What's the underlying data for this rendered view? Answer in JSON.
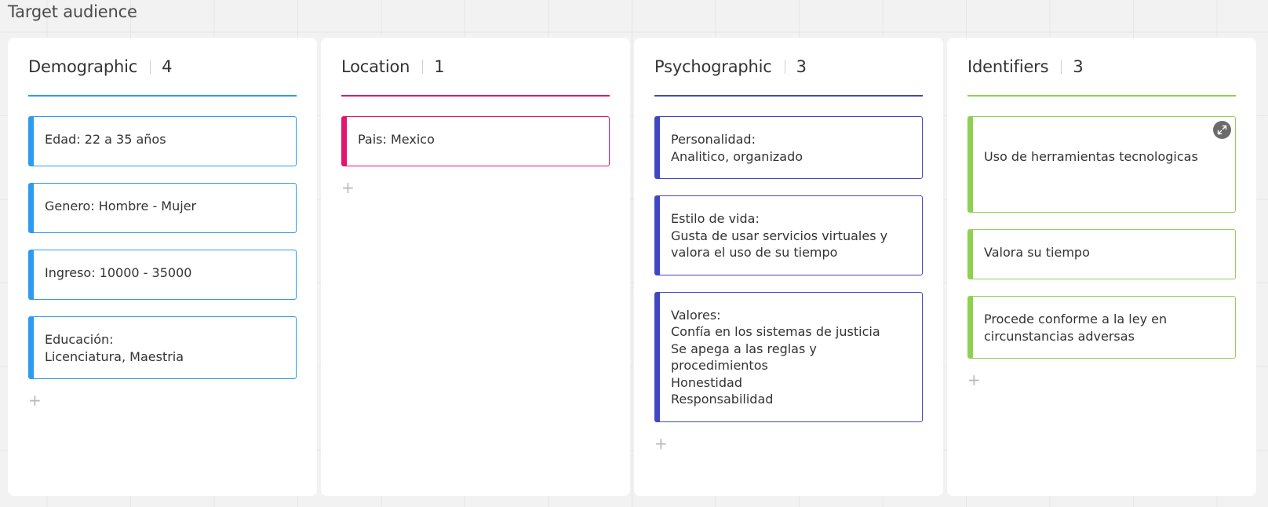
{
  "board": {
    "title": "Target audience"
  },
  "add_glyph": "+",
  "columns": [
    {
      "name": "Demographic",
      "count": "4",
      "color": "#2d9bf0",
      "cards": [
        "Edad: 22 a 35 años",
        "Genero: Hombre - Mujer",
        "Ingreso: 10000 - 35000",
        "Educación:\nLicenciatura, Maestria"
      ]
    },
    {
      "name": "Location",
      "count": "1",
      "color": "#e0166f",
      "cards": [
        "Pais: Mexico"
      ]
    },
    {
      "name": "Psychographic",
      "count": "3",
      "color": "#4146c2",
      "cards": [
        "Personalidad:\nAnalitico, organizado",
        "Estilo de vida:\nGusta de usar servicios virtuales y\nvalora el uso de su tiempo",
        "Valores:\nConfía en los sistemas de justicia\nSe apega a las reglas y\nprocedimientos\nHonestidad\nResponsabilidad"
      ]
    },
    {
      "name": "Identifiers",
      "count": "3",
      "color": "#8fd14f",
      "cards": [
        "Uso de herramientas tecnologicas",
        "Valora su tiempo",
        "Procede conforme a la ley en\ncircunstancias adversas"
      ],
      "expand_icon": "expand-icon"
    }
  ]
}
